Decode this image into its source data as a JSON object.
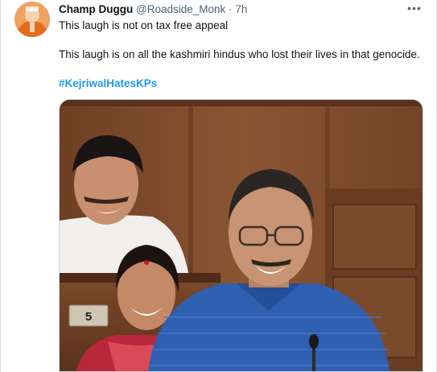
{
  "tweet": {
    "author": {
      "name": "Champ Duggu",
      "handle": "@Roadside_Monk",
      "separator": "·",
      "time": "7h"
    },
    "more_label": "•••",
    "lines": [
      "This laugh is not on tax free appeal",
      "This laugh is on all the kashmiri hindus who lost their lives in that genocide."
    ],
    "hashtag": "#KejriwalHatesKPs",
    "media": {
      "desk_number": "5"
    }
  },
  "colors": {
    "link": "#1d9bf0",
    "secondary_text": "#536471",
    "primary_text": "#0f1419"
  }
}
